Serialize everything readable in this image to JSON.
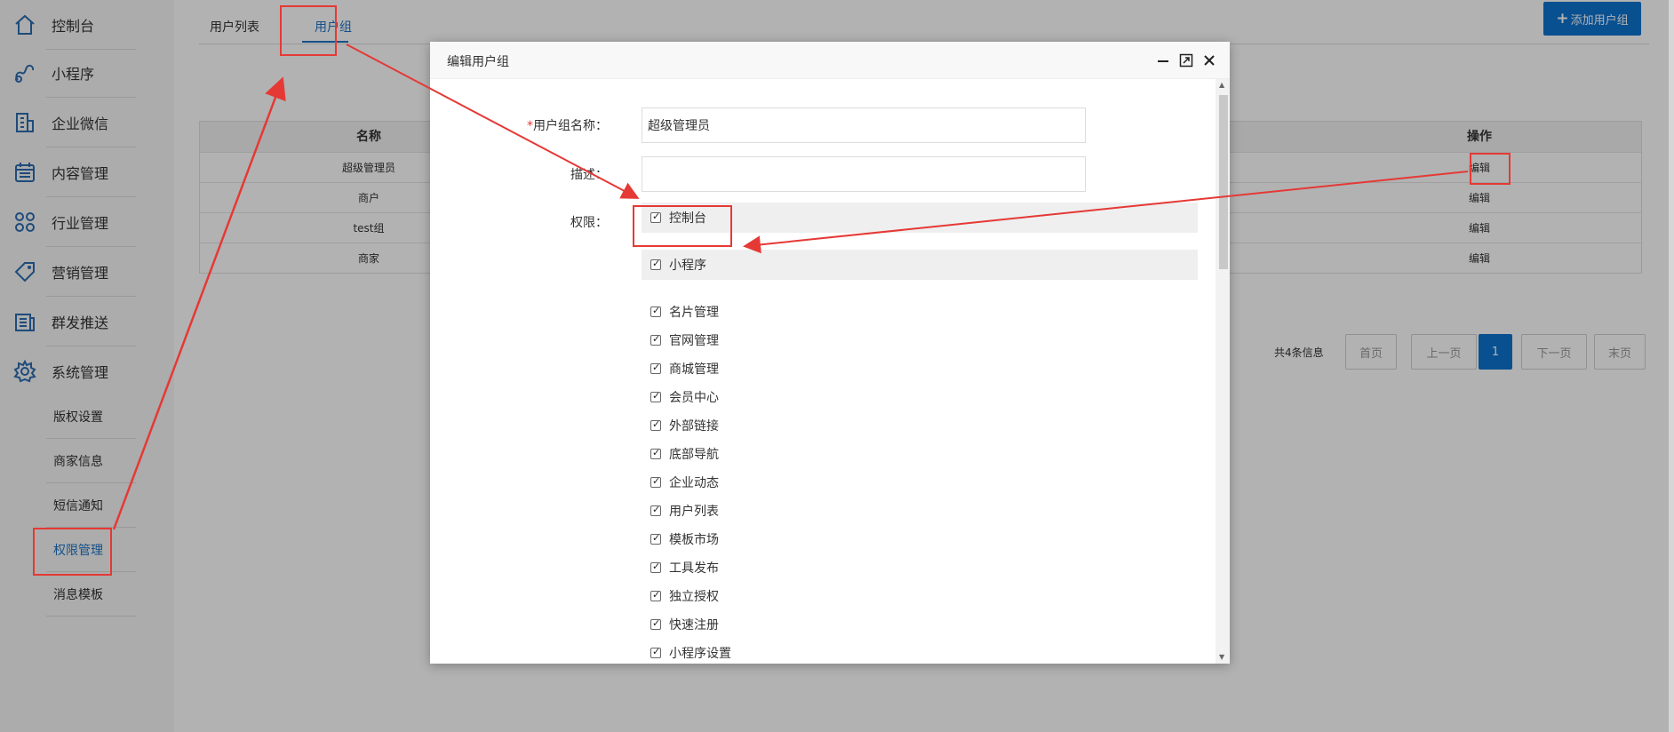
{
  "sidebar": {
    "items": [
      {
        "label": "控制台",
        "icon": "home-icon"
      },
      {
        "label": "小程序",
        "icon": "link-icon"
      },
      {
        "label": "企业微信",
        "icon": "building-icon"
      },
      {
        "label": "内容管理",
        "icon": "calendar-icon"
      },
      {
        "label": "行业管理",
        "icon": "command-icon"
      },
      {
        "label": "营销管理",
        "icon": "tag-icon"
      },
      {
        "label": "群发推送",
        "icon": "document-icon"
      },
      {
        "label": "系统管理",
        "icon": "gear-icon"
      }
    ],
    "sub_items": [
      {
        "label": "版权设置"
      },
      {
        "label": "商家信息"
      },
      {
        "label": "短信通知"
      },
      {
        "label": "权限管理",
        "active": true
      },
      {
        "label": "消息模板"
      }
    ]
  },
  "tabs": [
    {
      "label": "用户列表"
    },
    {
      "label": "用户组",
      "active": true
    }
  ],
  "add_button": {
    "label": "添加用户组",
    "icon": "plus-icon"
  },
  "table": {
    "headers": {
      "name": "名称",
      "op": "操作"
    },
    "rows": [
      {
        "name": "超级管理员",
        "op": "编辑"
      },
      {
        "name": "商户",
        "op": "编辑"
      },
      {
        "name": "test组",
        "op": "编辑"
      },
      {
        "name": "商家",
        "op": "编辑"
      }
    ]
  },
  "pagination": {
    "info": "共4条信息",
    "first": "首页",
    "prev": "上一页",
    "current": "1",
    "next": "下一页",
    "last": "末页"
  },
  "modal": {
    "title": "编辑用户组",
    "form": {
      "name_label": "用户组名称：",
      "name_required_mark": "*",
      "name_value": "超级管理员",
      "desc_label": "描述：",
      "desc_value": "",
      "perm_label": "权限："
    },
    "permissions": {
      "group1": "控制台",
      "group2": "小程序",
      "items": [
        "名片管理",
        "官网管理",
        "商城管理",
        "会员中心",
        "外部链接",
        "底部导航",
        "企业动态",
        "用户列表",
        "模板市场",
        "工具发布",
        "独立授权",
        "快速注册",
        "小程序设置"
      ]
    },
    "header_icons": [
      "minimize-icon",
      "maximize-icon",
      "close-icon"
    ]
  },
  "colors": {
    "accent": "#1e73c6",
    "primary_button": "#0d73cf",
    "annotation": "#e53935"
  }
}
